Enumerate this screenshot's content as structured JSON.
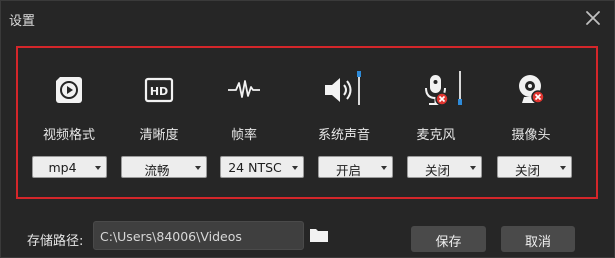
{
  "window": {
    "title": "设置"
  },
  "settings": [
    {
      "icon": "video-play-icon",
      "label": "视频格式",
      "value": "mp4"
    },
    {
      "icon": "hd-icon",
      "label": "清晰度",
      "value": "流畅"
    },
    {
      "icon": "waveform-icon",
      "label": "帧率",
      "value": "24 NTSC"
    },
    {
      "icon": "speaker-icon",
      "label": "系统声音",
      "value": "开启",
      "volume_level": 1.0
    },
    {
      "icon": "microphone-disabled-icon",
      "label": "麦克风",
      "value": "关闭",
      "volume_level": 0.0
    },
    {
      "icon": "webcam-disabled-icon",
      "label": "摄像头",
      "value": "关闭"
    }
  ],
  "footer": {
    "path_label": "存储路径:",
    "path_value": "C:\\Users\\84006\\Videos",
    "folder_icon": "folder-icon",
    "save_label": "保存",
    "cancel_label": "取消"
  },
  "colors": {
    "background": "#262626",
    "highlight_border": "#d4262a",
    "slider_thumb": "#2e8bd9",
    "disabled_badge": "#e0342f"
  }
}
